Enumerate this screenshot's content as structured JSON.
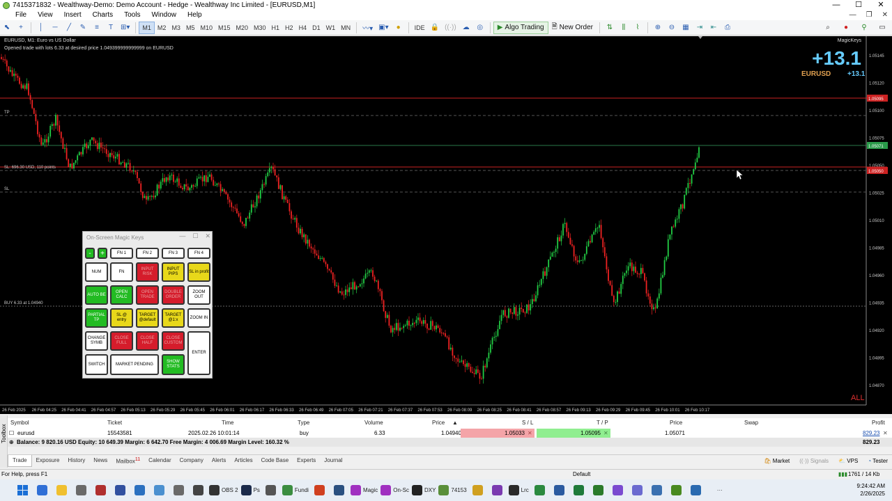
{
  "window": {
    "title": "7415371832 - Wealthway-Demo: Demo Account - Hedge - Wealthway Inc Limited - [EURUSD,M1]",
    "controls": [
      "—",
      "☐",
      "✕"
    ]
  },
  "menu": [
    "File",
    "View",
    "Insert",
    "Charts",
    "Tools",
    "Window",
    "Help"
  ],
  "mdi_controls": [
    "—",
    "❐",
    "✕"
  ],
  "toolbar": {
    "timeframes": [
      "M1",
      "M2",
      "M3",
      "M5",
      "M10",
      "M15",
      "M20",
      "M30",
      "H1",
      "H2",
      "H4",
      "D1",
      "W1",
      "MN"
    ],
    "active_timeframe": "M1",
    "ide_label": "IDE",
    "algo_trading_label": "Algo Trading",
    "new_order_label": "New Order"
  },
  "chart": {
    "symbol_label": "EURUSD, M1:  Euro vs US Dollar",
    "message": "Opened trade with lots 6.33 at desired price 1.049399999999999 on EURUSD",
    "magickeys_label": "MagicKeys",
    "profit_big": "+13.1",
    "profit_symbol": "EURUSD",
    "profit_small": "+13.1",
    "all_label": "ALL",
    "tp_label": "TP",
    "sl_info_label": "SL: 696.30 USD, 110 points",
    "sl_label": "SL",
    "buy_label": "BUY 6.33 at 1.04940",
    "price_labels": [
      "1.05145",
      "1.05120",
      "1.05100",
      "1.05075",
      "1.05050",
      "1.05025",
      "1.05010",
      "1.04985",
      "1.04960",
      "1.04935",
      "1.04920",
      "1.04895",
      "1.04870"
    ],
    "tag_tp": "1.05095",
    "tag_current": "1.05071",
    "tag_sl": "1.05050",
    "time_labels": [
      "26 Feb 2025",
      "26 Feb 04:25",
      "26 Feb 04:41",
      "26 Feb 04:57",
      "26 Feb 05:13",
      "26 Feb 05:29",
      "26 Feb 05:45",
      "26 Feb 06:01",
      "26 Feb 06:17",
      "26 Feb 06:33",
      "26 Feb 06:49",
      "26 Feb 07:05",
      "26 Feb 07:21",
      "26 Feb 07:37",
      "26 Feb 07:53",
      "26 Feb 08:09",
      "26 Feb 08:25",
      "26 Feb 08:41",
      "26 Feb 08:57",
      "26 Feb 09:13",
      "26 Feb 09:29",
      "26 Feb 09:45",
      "26 Feb 10:01",
      "26 Feb 10:17"
    ],
    "colors": {
      "bull": "#22cc44",
      "bear": "#ee2222",
      "tp_line": "#cc2222",
      "sl_line": "#cc2222",
      "current": "#33bb55"
    }
  },
  "magic_keys": {
    "title": "On-Screen Magic Keys",
    "controls": [
      "—",
      "☐",
      "✕"
    ],
    "keys": {
      "minus": "-",
      "plus": "+",
      "fn1": "FN 1",
      "fn2": "FN 2",
      "fn3": "FN 3",
      "fn4": "FN 4",
      "num": "NUM",
      "fn": "FN",
      "input_risk": "INPUT RISK",
      "input_pips": "INPUT PIPS",
      "sl_in_profit": "SL in profit",
      "auto_be": "AUTO BE",
      "open_calc": "OPEN CALC",
      "open_trade": "OPEN TRADE",
      "double_order": "DOUBLE ORDER",
      "zoom_out": "ZOOM OUT",
      "partial_tp": "PARTIAL TP",
      "sl_entry": "SL @ entry",
      "target_default": "TARGET @default",
      "target_1x": "TARGET @1:x",
      "zoom_in": "ZOOM IN",
      "change_symb": "CHANGE SYMB",
      "close_full": "CLOSE FULL",
      "close_half": "CLOSE HALF",
      "close_custom": "CLOSE CUSTOM",
      "enter": "ENTER",
      "switch": "SWITCH",
      "market_pending": "MARKET PENDING",
      "show_stats": "SHOW STATS"
    }
  },
  "trade_table": {
    "headers": {
      "symbol": "Symbol",
      "ticket": "Ticket",
      "time": "Time",
      "type": "Type",
      "volume": "Volume",
      "price": "Price",
      "sl": "S / L",
      "tp": "T / P",
      "price2": "Price",
      "swap": "Swap",
      "profit": "Profit"
    },
    "row": {
      "symbol": "eurusd",
      "ticket": "15543581",
      "time": "2025.02.26 10:01:14",
      "type": "buy",
      "volume": "6.33",
      "price": "1.04940",
      "sl": "1.05033",
      "tp": "1.05095",
      "price2": "1.05071",
      "swap": "",
      "profit": "829.23"
    },
    "balance_line": "Balance: 9 820.16 USD  Equity: 10 649.39  Margin: 6 642.70  Free Margin: 4 006.69  Margin Level: 160.32 %",
    "balance_profit": "829.23"
  },
  "bottom_tabs": [
    "Trade",
    "Exposure",
    "History",
    "News",
    "Mailbox",
    "Calendar",
    "Company",
    "Alerts",
    "Articles",
    "Code Base",
    "Experts",
    "Journal"
  ],
  "mailbox_badge": "11",
  "right_tabs": {
    "market": "Market",
    "signals": "Signals",
    "vps": "VPS",
    "tester": "Tester"
  },
  "toolbox_label": "Toolbox",
  "status": {
    "help": "For Help, press F1",
    "profile": "Default",
    "traffic": "1761 / 14 Kb"
  },
  "taskbar": {
    "items": [
      {
        "label": "",
        "color": "#2f6fd6"
      },
      {
        "label": "",
        "color": "#f0c030"
      },
      {
        "label": "",
        "color": "#6a6a6a"
      },
      {
        "label": "",
        "color": "#b03030"
      },
      {
        "label": "",
        "color": "#3050a0"
      },
      {
        "label": "",
        "color": "#2a70c0"
      },
      {
        "label": "",
        "color": "#4a90d0"
      },
      {
        "label": "",
        "color": "#6a6a6a"
      },
      {
        "label": "",
        "color": "#444"
      },
      {
        "label": "OBS 2",
        "color": "#333"
      },
      {
        "label": "Ps",
        "color": "#1b2a4a"
      },
      {
        "label": "",
        "color": "#555"
      },
      {
        "label": "Fundi",
        "color": "#3b8d40"
      },
      {
        "label": "",
        "color": "#d04020"
      },
      {
        "label": "",
        "color": "#2a5080"
      },
      {
        "label": "Magic",
        "color": "#a030c0"
      },
      {
        "label": "On-Sc",
        "color": "#a030c0"
      },
      {
        "label": "DXY",
        "color": "#222"
      },
      {
        "label": "74153",
        "color": "#5a8f3a"
      },
      {
        "label": "",
        "color": "#d0a020"
      },
      {
        "label": "",
        "color": "#7a3ab0"
      },
      {
        "label": "Lrc",
        "color": "#2a2a2a"
      },
      {
        "label": "",
        "color": "#2a8a40"
      },
      {
        "label": "",
        "color": "#2a5aa0"
      },
      {
        "label": "",
        "color": "#1e7a3a"
      },
      {
        "label": "",
        "color": "#2a7a2a"
      },
      {
        "label": "",
        "color": "#7a4ad0"
      },
      {
        "label": "",
        "color": "#6a6ad0"
      },
      {
        "label": "",
        "color": "#3a70b0"
      },
      {
        "label": "",
        "color": "#4a8a20"
      },
      {
        "label": "",
        "color": "#2a6ab0"
      }
    ],
    "more": "···",
    "time": "9:24:42 AM",
    "date": "2/26/2025"
  }
}
